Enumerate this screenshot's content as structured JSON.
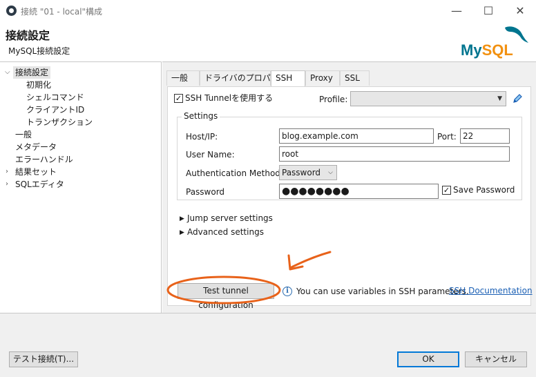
{
  "window": {
    "title": "接続 \"01 - local\"構成",
    "minimize_glyph": "—",
    "maximize_glyph": "☐",
    "close_glyph": "✕"
  },
  "header": {
    "title": "接続設定",
    "subtitle": "MySQL接続設定",
    "logo_text": "MySQL"
  },
  "sidebar": {
    "items": [
      {
        "label": "接続設定",
        "expanded": true,
        "selected": true
      },
      {
        "label": "初期化"
      },
      {
        "label": "シェルコマンド"
      },
      {
        "label": "クライアントID"
      },
      {
        "label": "トランザクション"
      },
      {
        "label": "一般"
      },
      {
        "label": "メタデータ"
      },
      {
        "label": "エラーハンドル"
      },
      {
        "label": "結果セット",
        "expandable": true
      },
      {
        "label": "SQLエディタ",
        "expandable": true
      }
    ]
  },
  "tabs": [
    {
      "label": "一般"
    },
    {
      "label": "ドライバのプロパティ"
    },
    {
      "label": "SSH",
      "active": true
    },
    {
      "label": "Proxy"
    },
    {
      "label": "SSL"
    }
  ],
  "ssh": {
    "use_tunnel_label": "SSH Tunnelを使用する",
    "use_tunnel_checked": true,
    "profile_label": "Profile:",
    "profile_value": "",
    "settings_group_title": "Settings",
    "host_label": "Host/IP:",
    "host_value": "blog.example.com",
    "port_label": "Port:",
    "port_value": "22",
    "user_label": "User Name:",
    "user_value": "root",
    "auth_label": "Authentication Method:",
    "auth_value": "Password",
    "password_label": "Password",
    "password_mask": "●●●●●●●●",
    "save_password_label": "Save Password",
    "save_password_checked": true,
    "jump_server_label": "Jump server settings",
    "advanced_label": "Advanced settings",
    "test_button_label": "Test tunnel configuration",
    "info_text": "You can use variables in SSH parameters.",
    "doc_link_label": "SSH Documentation"
  },
  "footer": {
    "test_connection_label": "テスト接続(T)...",
    "ok_label": "OK",
    "cancel_label": "キャンセル"
  },
  "colors": {
    "annotation": "#e8621a",
    "mysql_blue": "#00758f",
    "mysql_orange": "#f29111",
    "link": "#1a5fb4"
  }
}
